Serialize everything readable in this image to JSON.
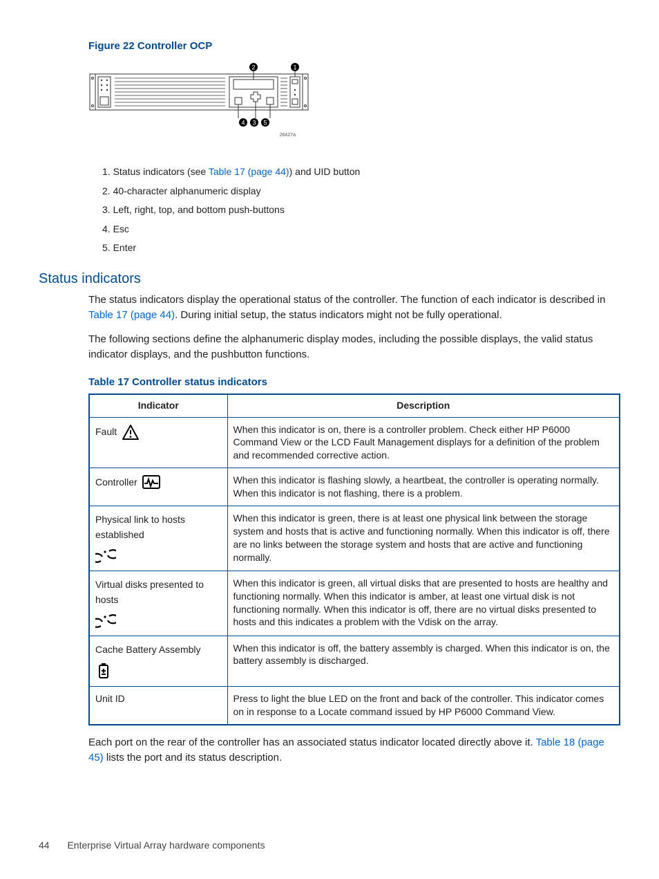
{
  "figure": {
    "caption": "Figure 22 Controller OCP",
    "callouts": [
      "1",
      "2",
      "3",
      "4",
      "5"
    ],
    "diagram_id": "26427a"
  },
  "legend": {
    "items": [
      {
        "num": "1.",
        "pre": "Status indicators (see ",
        "link": "Table 17 (page 44)",
        "post": ") and UID button"
      },
      {
        "num": "2.",
        "pre": "",
        "link": "",
        "post": "40-character alphanumeric display"
      },
      {
        "num": "3.",
        "pre": "",
        "link": "",
        "post": "Left, right, top, and bottom push-buttons"
      },
      {
        "num": "4.",
        "pre": "",
        "link": "",
        "post": "Esc"
      },
      {
        "num": "5.",
        "pre": "",
        "link": "",
        "post": "Enter"
      }
    ]
  },
  "section": {
    "title": "Status indicators",
    "para1a": "The status indicators display the operational status of the controller. The function of each indicator is described in ",
    "para1_link": "Table 17 (page 44)",
    "para1b": ". During initial setup, the status indicators might not be fully operational.",
    "para2": "The following sections define the alphanumeric display modes, including the possible displays, the valid status indicator displays, and the pushbutton functions."
  },
  "table": {
    "caption": "Table 17 Controller status indicators",
    "headers": [
      "Indicator",
      "Description"
    ],
    "rows": [
      {
        "indicator": "Fault",
        "icon": "fault",
        "description": "When this indicator is on, there is a controller problem. Check either HP P6000 Command View or the LCD Fault Management displays for a definition of the problem and recommended corrective action."
      },
      {
        "indicator": "Controller",
        "icon": "heartbeat",
        "description": "When this indicator is flashing slowly, a heartbeat, the controller is operating normally. When this indicator is not flashing, there is a problem."
      },
      {
        "indicator": "Physical link to hosts established",
        "icon": "link",
        "description": "When this indicator is green, there is at least one physical link between the storage system and hosts that is active and functioning normally. When this indicator is off, there are no links between the storage system and hosts that are active and functioning normally."
      },
      {
        "indicator": "Virtual disks presented to hosts",
        "icon": "link",
        "description": "When this indicator is green, all virtual disks that are presented to hosts are healthy and functioning normally. When this indicator is amber, at least one virtual disk is not functioning normally. When this indicator is off, there are no virtual disks presented to hosts and this indicates a problem with the Vdisk on the array."
      },
      {
        "indicator": "Cache Battery Assembly",
        "icon": "battery",
        "description": "When this indicator is off, the battery assembly is charged. When this indicator is on, the battery assembly is discharged."
      },
      {
        "indicator": "Unit ID",
        "icon": "",
        "description": "Press to light the blue LED on the front and back of the controller. This indicator comes on in response to a Locate command issued by HP P6000 Command View."
      }
    ]
  },
  "after_table": {
    "pre": "Each port on the rear of the controller has an associated status indicator located directly above it. ",
    "link": "Table 18 (page 45)",
    "post": " lists the port and its status description."
  },
  "footer": {
    "page": "44",
    "section": "Enterprise Virtual Array hardware components"
  }
}
